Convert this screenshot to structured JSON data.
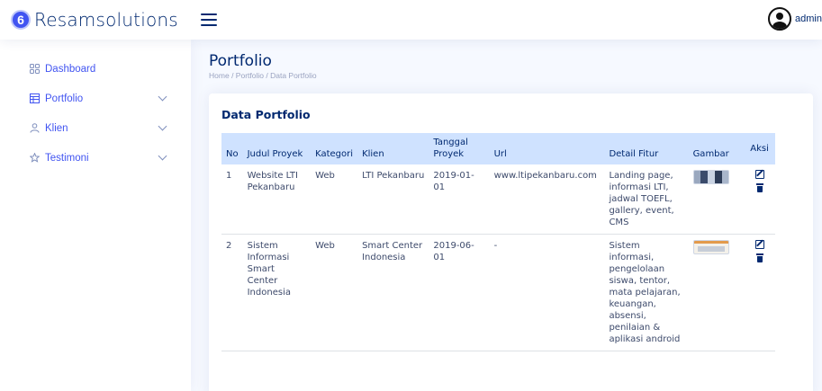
{
  "app": {
    "logo_mark": "6",
    "name": "Resamsolutions",
    "user": "admin"
  },
  "sidebar": {
    "items": [
      {
        "label": "Dashboard",
        "icon": "grid-icon",
        "has_chevron": false
      },
      {
        "label": "Portfolio",
        "icon": "layout-icon",
        "has_chevron": true
      },
      {
        "label": "Klien",
        "icon": "person-icon",
        "has_chevron": true
      },
      {
        "label": "Testimoni",
        "icon": "star-icon",
        "has_chevron": true
      }
    ]
  },
  "page": {
    "title": "Portfolio",
    "breadcrumb": [
      "Home",
      "Portfolio",
      "Data Portfolio"
    ]
  },
  "card": {
    "title": "Data Portfolio",
    "columns": [
      "No",
      "Judul Proyek",
      "Kategori",
      "Klien",
      "Tanggal Proyek",
      "Url",
      "Detail Fitur",
      "Gambar",
      "Aksi"
    ],
    "rows": [
      {
        "no": "1",
        "judul": "Website LTI Pekanbaru",
        "kategori": "Web",
        "klien": "LTI Pekanbaru",
        "tanggal": "2019-01-01",
        "url": "www.ltipekanbaru.com",
        "detail": "Landing page, informasi LTI, jadwal TOEFL, gallery, event, CMS"
      },
      {
        "no": "2",
        "judul": "Sistem Informasi Smart Center Indonesia",
        "kategori": "Web",
        "klien": "Smart Center Indonesia",
        "tanggal": "2019-06-01",
        "url": "-",
        "detail": "Sistem informasi, pengelolaan siswa, tentor, mata pelajaran, keuangan, absensi, penilaian & aplikasi android"
      }
    ]
  },
  "colors": {
    "accent": "#4154f1",
    "navy": "#012970",
    "table_header": "#cfe2ff",
    "background": "#f6f9ff"
  }
}
